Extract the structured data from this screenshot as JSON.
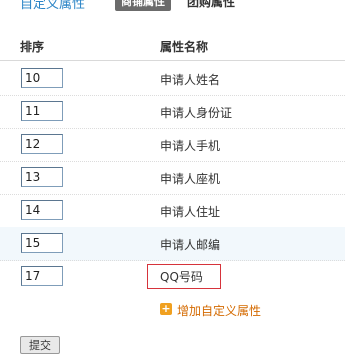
{
  "tabs": {
    "title": "自定义属性",
    "active_tab": "商铺属性",
    "other_tab": "团购属性"
  },
  "table": {
    "col_sort": "排序",
    "col_name": "属性名称",
    "rows": [
      {
        "order": "10",
        "name": "申请人姓名"
      },
      {
        "order": "11",
        "name": "申请人身份证"
      },
      {
        "order": "12",
        "name": "申请人手机"
      },
      {
        "order": "13",
        "name": "申请人座机"
      },
      {
        "order": "14",
        "name": "申请人住址"
      },
      {
        "order": "15",
        "name": "申请人邮编"
      },
      {
        "order": "17",
        "name": "QQ号码"
      }
    ]
  },
  "add_link": {
    "icon": "plus-icon",
    "label": "增加自定义属性"
  },
  "submit_label": "提交",
  "colors": {
    "accent": "#2a84c6",
    "link": "#d46a00",
    "highlight_border": "#d6333b"
  }
}
